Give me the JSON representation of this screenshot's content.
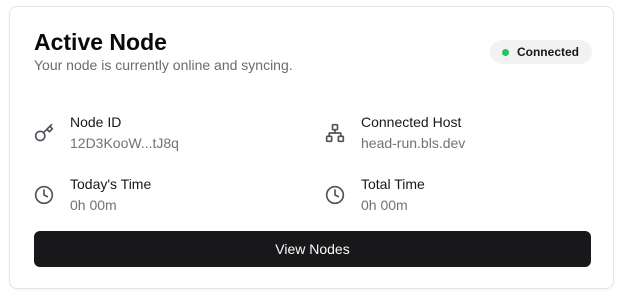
{
  "card": {
    "title": "Active Node",
    "subtitle": "Your node is currently online and syncing."
  },
  "status": {
    "label": "Connected",
    "dot_color": "#22c55e"
  },
  "details": [
    {
      "icon": "key-icon",
      "label": "Node ID",
      "value": "12D3KooW...tJ8q"
    },
    {
      "icon": "network-icon",
      "label": "Connected Host",
      "value": "head-run.bls.dev"
    },
    {
      "icon": "clock-icon",
      "label": "Today's Time",
      "value": "0h 00m"
    },
    {
      "icon": "clock-icon",
      "label": "Total Time",
      "value": "0h 00m"
    }
  ],
  "actions": {
    "view_nodes_label": "View Nodes"
  },
  "colors": {
    "button_bg": "#18181b",
    "button_text": "#fafafa",
    "status_bg": "#f2f2f3"
  }
}
